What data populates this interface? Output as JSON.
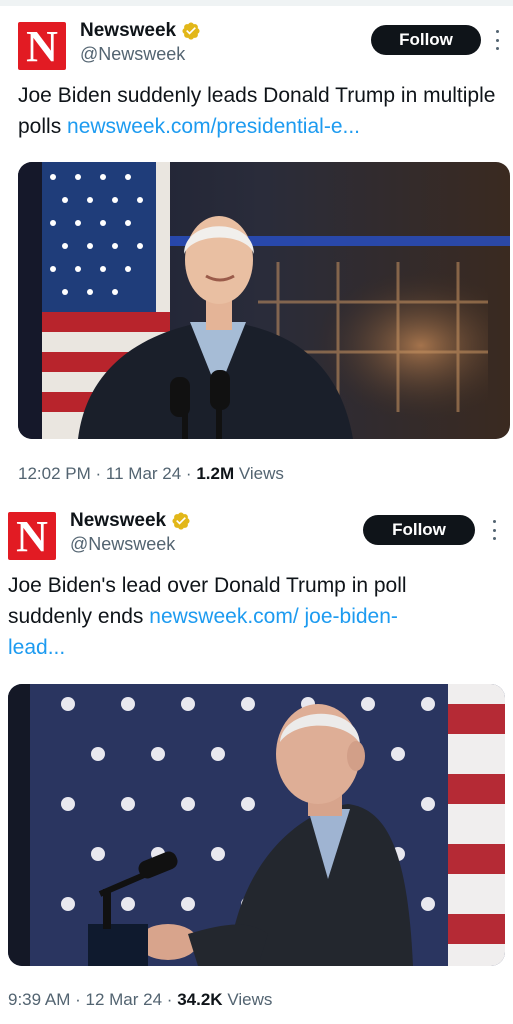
{
  "tweets": [
    {
      "author_name": "Newsweek",
      "handle": "@Newsweek",
      "logo_letter": "N",
      "follow_label": "Follow",
      "text": "Joe Biden suddenly leads Donald Trump in multiple polls ",
      "link": "newsweek.com/presidential-e...",
      "time": "12:02 PM",
      "date": "11 Mar 24",
      "views_count": "1.2M",
      "views_label": "Views"
    },
    {
      "author_name": "Newsweek",
      "handle": "@Newsweek",
      "logo_letter": "N",
      "follow_label": "Follow",
      "text": "Joe Biden's lead over Donald Trump in poll suddenly ends ",
      "link": "newsweek.com/ joe-biden-lead...",
      "time": "9:39 AM",
      "date": "12 Mar 24",
      "views_count": "34.2K",
      "views_label": "Views"
    }
  ],
  "separator": "·",
  "colors": {
    "brand_red": "#e21b23",
    "link_blue": "#1d9bf0",
    "verified_gold": "#e2b719",
    "follow_bg": "#0f1419",
    "muted": "#536471"
  },
  "icons": [
    "verified-badge-icon",
    "more-options-icon"
  ]
}
